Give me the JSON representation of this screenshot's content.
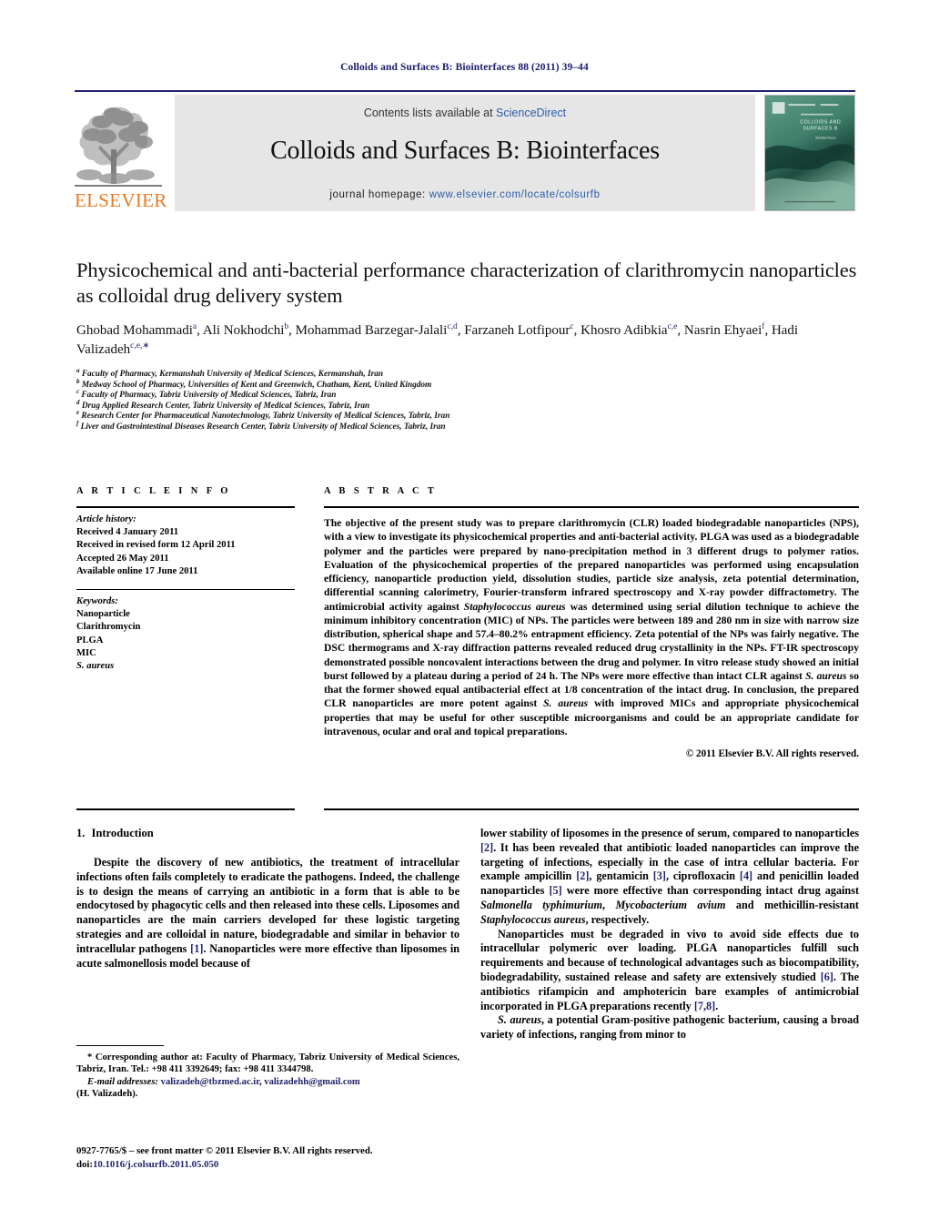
{
  "running_head": "Colloids and Surfaces B: Biointerfaces 88 (2011) 39–44",
  "masthead": {
    "publisher_wordmark": "ELSEVIER",
    "contents_prefix": "Contents lists available at ",
    "contents_link": "ScienceDirect",
    "journal_title": "Colloids and Surfaces B: Biointerfaces",
    "homepage_prefix": "journal homepage: ",
    "homepage_url": "www.elsevier.com/locate/colsurfb",
    "cover_title_line1": "COLLOIDS AND",
    "cover_title_line2": "SURFACES B",
    "cover_subtitle": "Biointerfaces",
    "accent_link_color": "#2a5caa",
    "publisher_color": "#e87a22",
    "cover_color": "#3f7f6b"
  },
  "article": {
    "title": "Physicochemical and anti-bacterial performance characterization of clarithromycin nanoparticles as colloidal drug delivery system",
    "authors": [
      {
        "name": "Ghobad Mohammadi",
        "marks": "a",
        "sep": ", "
      },
      {
        "name": "Ali Nokhodchi",
        "marks": "b",
        "sep": ", "
      },
      {
        "name": "Mohammad Barzegar-Jalali",
        "marks": "c,d",
        "sep": ", "
      },
      {
        "name": "Farzaneh Lotfipour",
        "marks": "c",
        "sep": ", "
      },
      {
        "name": "Khosro Adibkia",
        "marks": "c,e",
        "sep": ", "
      },
      {
        "name": "Nasrin Ehyaei",
        "marks": "f",
        "sep": ", "
      },
      {
        "name": "Hadi Valizadeh",
        "marks": "c,e,∗",
        "sep": ""
      }
    ],
    "affiliations": [
      {
        "mark": "a",
        "text": "Faculty of Pharmacy, Kermanshah University of Medical Sciences, Kermanshah, Iran"
      },
      {
        "mark": "b",
        "text": "Medway School of Pharmacy, Universities of Kent and Greenwich, Chatham, Kent, United Kingdom"
      },
      {
        "mark": "c",
        "text": "Faculty of Pharmacy, Tabriz University of Medical Sciences, Tabriz, Iran"
      },
      {
        "mark": "d",
        "text": "Drug Applied Research Center, Tabriz University of Medical Sciences, Tabriz, Iran"
      },
      {
        "mark": "e",
        "text": "Research Center for Pharmaceutical Nanotechnology, Tabriz University of Medical Sciences, Tabriz, Iran"
      },
      {
        "mark": "f",
        "text": "Liver and Gastrointestinal Diseases Research Center, Tabriz University of Medical Sciences, Tabriz, Iran"
      }
    ]
  },
  "article_info": {
    "heading": "A R T I C L E    I N F O",
    "history_heading": "Article history:",
    "history": [
      "Received 4 January 2011",
      "Received in revised form 12 April 2011",
      "Accepted 26 May 2011",
      "Available online 17 June 2011"
    ],
    "keywords_heading": "Keywords:",
    "keywords": [
      "Nanoparticle",
      "Clarithromycin",
      "PLGA",
      "MIC",
      "S. aureus"
    ]
  },
  "abstract": {
    "heading": "A B S T R A C T",
    "text_parts": [
      {
        "t": "The objective of the present study was to prepare clarithromycin (CLR) loaded biodegradable nanoparticles (NPS), with a view to investigate its physicochemical properties and anti-bacterial activity. PLGA was used as a biodegradable polymer and the particles were prepared by nano-precipitation method in 3 different drugs to polymer ratios. Evaluation of the physicochemical properties of the prepared nanoparticles was performed using encapsulation efficiency, nanoparticle production yield, dissolution studies, particle size analysis, zeta potential determination, differential scanning calorimetry, Fourier-transform infrared spectroscopy and X-ray powder diffractometry. The antimicrobial activity against ",
        "i": false
      },
      {
        "t": "Staphylococcus aureus",
        "i": true
      },
      {
        "t": " was determined using serial dilution technique to achieve the minimum inhibitory concentration (MIC) of NPs. The particles were between 189 and 280 nm in size with narrow size distribution, spherical shape and 57.4–80.2% entrapment efficiency. Zeta potential of the NPs was fairly negative. The DSC thermograms and X-ray diffraction patterns revealed reduced drug crystallinity in the NPs. FT-IR spectroscopy demonstrated possible noncovalent interactions between the drug and polymer. In vitro release study showed an initial burst followed by a plateau during a period of 24 h. The NPs were more effective than intact CLR against ",
        "i": false
      },
      {
        "t": "S. aureus",
        "i": true
      },
      {
        "t": " so that the former showed equal antibacterial effect at 1/8 concentration of the intact drug. In conclusion, the prepared CLR nanoparticles are more potent against ",
        "i": false
      },
      {
        "t": "S. aureus",
        "i": true
      },
      {
        "t": " with improved MICs and appropriate physicochemical properties that may be useful for other susceptible microorganisms and could be an appropriate candidate for intravenous, ocular and oral and topical preparations.",
        "i": false
      }
    ],
    "copyright": "© 2011 Elsevier B.V. All rights reserved."
  },
  "sections": {
    "intro_number": "1.",
    "intro_title": "Introduction",
    "left_paragraphs": [
      [
        {
          "t": "Despite the discovery of new antibiotics, the treatment of intracellular infections often fails completely to eradicate the pathogens. Indeed, the challenge is to design the means of carrying an antibiotic in a form that is able to be endocytosed by phagocytic cells and then released into these cells. Liposomes and nanoparticles are the main carriers developed for these logistic targeting strategies and are colloidal in nature, biodegradable and similar in behavior to intracellular pathogens ",
          "i": false
        },
        {
          "t": "[1]",
          "ref": true
        },
        {
          "t": ". Nanoparticles were more effective than liposomes in acute salmonellosis model because of",
          "i": false
        }
      ]
    ],
    "right_paragraphs": [
      {
        "indent": false,
        "parts": [
          {
            "t": "lower stability of liposomes in the presence of serum, compared to nanoparticles ",
            "i": false
          },
          {
            "t": "[2]",
            "ref": true
          },
          {
            "t": ". It has been revealed that antibiotic loaded nanoparticles can improve the targeting of infections, especially in the case of intra cellular bacteria. For example ampicillin ",
            "i": false
          },
          {
            "t": "[2]",
            "ref": true
          },
          {
            "t": ", gentamicin ",
            "i": false
          },
          {
            "t": "[3]",
            "ref": true
          },
          {
            "t": ", ciprofloxacin ",
            "i": false
          },
          {
            "t": "[4]",
            "ref": true
          },
          {
            "t": " and penicillin loaded nanoparticles ",
            "i": false
          },
          {
            "t": "[5]",
            "ref": true
          },
          {
            "t": " were more effective than corresponding intact drug against ",
            "i": false
          },
          {
            "t": "Salmonella typhimurium",
            "i": true
          },
          {
            "t": ", ",
            "i": false
          },
          {
            "t": "Mycobacterium avium",
            "i": true
          },
          {
            "t": " and methicillin-resistant ",
            "i": false
          },
          {
            "t": "Staphylococcus aureus",
            "i": true
          },
          {
            "t": ", respectively.",
            "i": false
          }
        ]
      },
      {
        "indent": true,
        "parts": [
          {
            "t": "Nanoparticles must be degraded in vivo to avoid side effects due to intracellular polymeric over loading. PLGA nanoparticles fulfill such requirements and because of technological advantages such as biocompatibility, biodegradability, sustained release and safety are extensively studied ",
            "i": false
          },
          {
            "t": "[6]",
            "ref": true
          },
          {
            "t": ". The antibiotics rifampicin and amphotericin bare examples of antimicrobial incorporated in PLGA preparations recently ",
            "i": false
          },
          {
            "t": "[7,8]",
            "ref": true
          },
          {
            "t": ".",
            "i": false
          }
        ]
      },
      {
        "indent": true,
        "parts": [
          {
            "t": "S. aureus",
            "i": true
          },
          {
            "t": ", a potential Gram-positive pathogenic bacterium, causing a broad variety of infections, ranging from minor to",
            "i": false
          }
        ]
      }
    ]
  },
  "footnotes": {
    "corresponding": "* Corresponding author at: Faculty of Pharmacy, Tabriz University of Medical Sciences, Tabriz, Iran. Tel.: +98 411 3392649; fax: +98 411 3344798.",
    "email_label": "E-mail addresses:",
    "email_1": "valizadeh@tbzmed.ac.ir",
    "email_sep": ", ",
    "email_2": "valizadehh@gmail.com",
    "email_author": "(H. Valizadeh).",
    "issn_line": "0927-7765/$ – see front matter © 2011 Elsevier B.V. All rights reserved.",
    "doi_label": "doi:",
    "doi_value": "10.1016/j.colsurfb.2011.05.050"
  }
}
